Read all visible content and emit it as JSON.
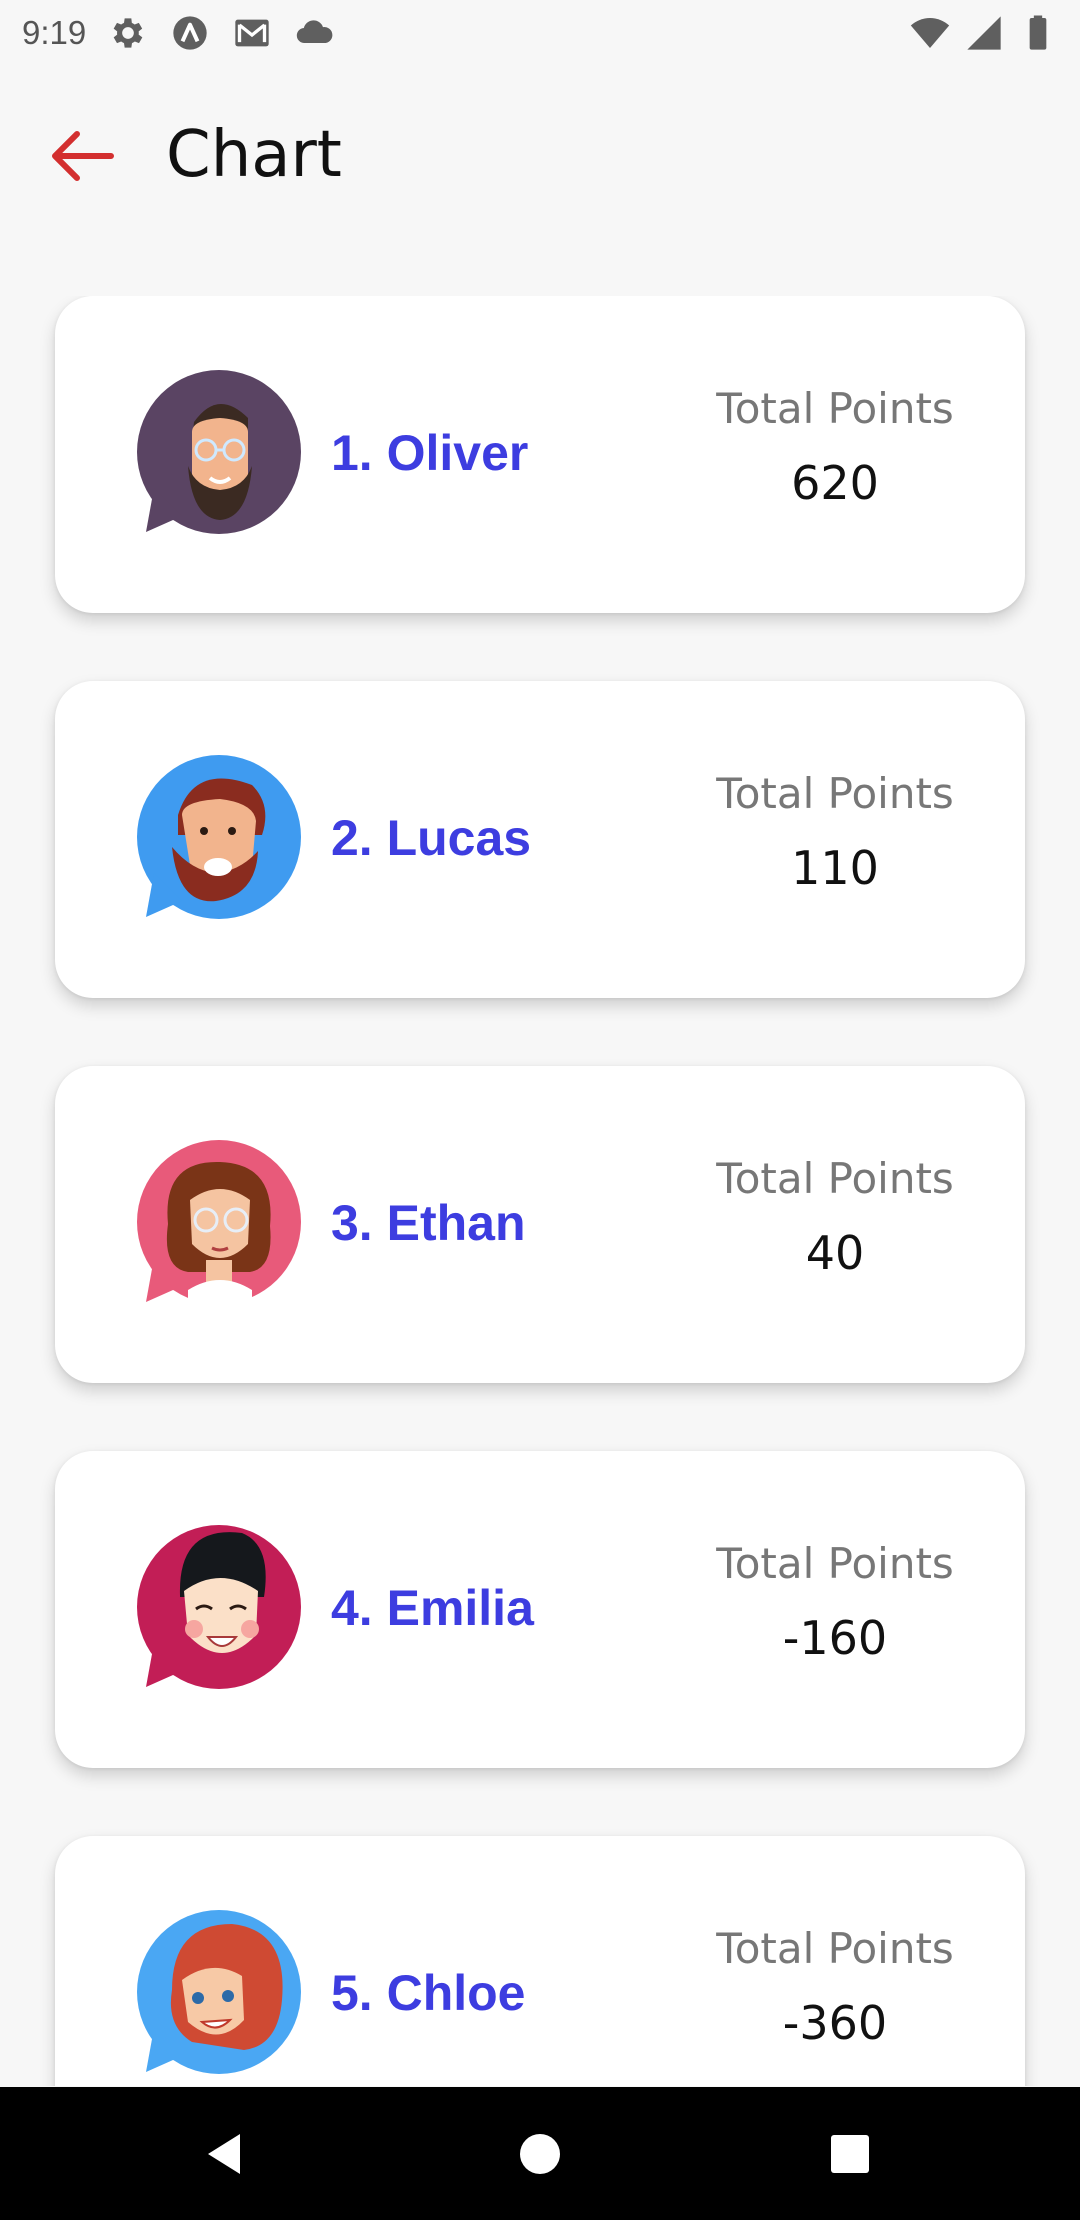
{
  "status_bar": {
    "time": "9:19",
    "icons": [
      "gear-icon",
      "a-circle-icon",
      "gmail-icon",
      "cloud-icon",
      "wifi-icon",
      "signal-icon",
      "battery-icon"
    ]
  },
  "app_bar": {
    "title": "Chart",
    "back_icon": "arrow-left-icon",
    "back_color": "#d32f2f"
  },
  "leaderboard": [
    {
      "name": "1. Oliver",
      "points_label": "Total Points",
      "points": "620",
      "avatar_bg": "#5a4463",
      "avatar_icon": "bearded-man-glasses-avatar"
    },
    {
      "name": "2. Lucas",
      "points_label": "Total Points",
      "points": "110",
      "avatar_bg": "#3f9bf0",
      "avatar_icon": "bearded-man-laughing-avatar"
    },
    {
      "name": "3. Ethan",
      "points_label": "Total Points",
      "points": "40",
      "avatar_bg": "#e85a7a",
      "avatar_icon": "woman-curly-hair-glasses-avatar"
    },
    {
      "name": "4. Emilia",
      "points_label": "Total Points",
      "points": "-160",
      "avatar_bg": "#c21e56",
      "avatar_icon": "smiling-boy-avatar"
    },
    {
      "name": "5. Chloe",
      "points_label": "Total Points",
      "points": "-360",
      "avatar_bg": "#4aa7f3",
      "avatar_icon": "red-haired-woman-avatar"
    }
  ],
  "colors": {
    "name_text": "#3d3de0",
    "label_text": "#777777",
    "background": "#f7f7f7",
    "card": "#ffffff"
  },
  "nav_bar": {
    "buttons": [
      "back-triangle-icon",
      "home-circle-icon",
      "recents-square-icon"
    ]
  }
}
